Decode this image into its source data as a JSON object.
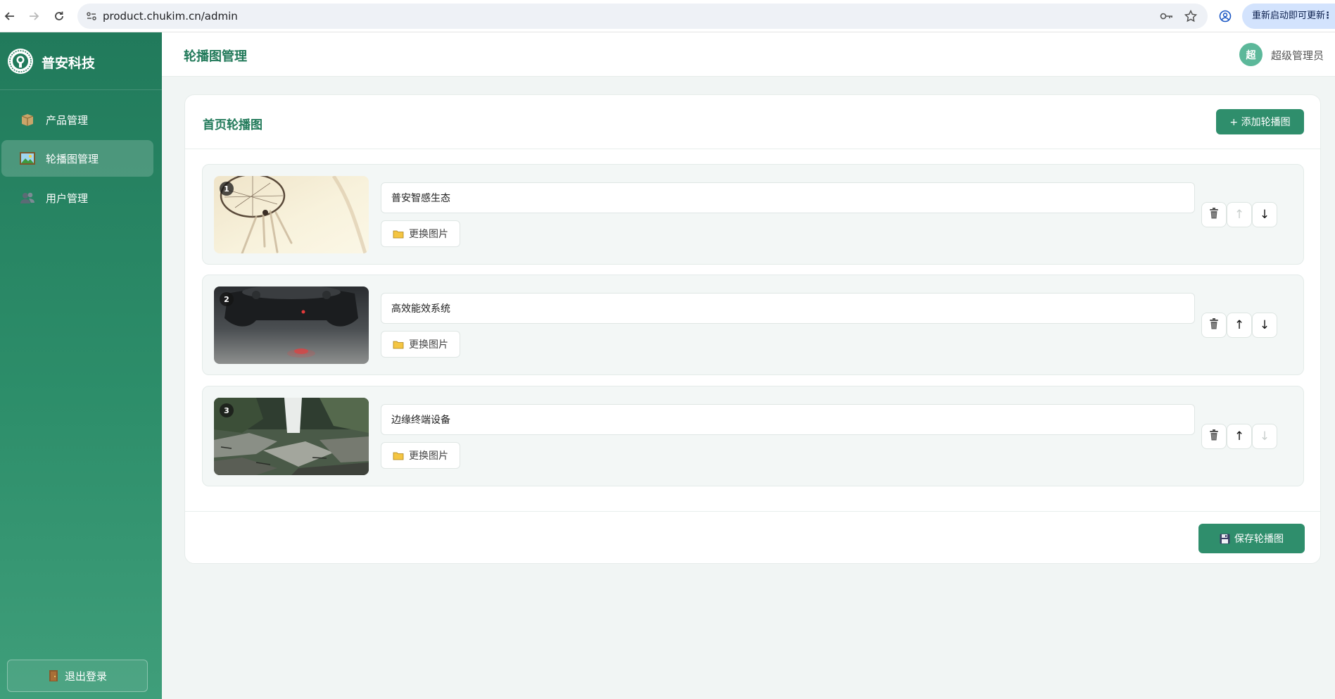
{
  "browser": {
    "url": "product.chukim.cn/admin",
    "update_label": "重新启动即可更新",
    "more_glyph": "⋮"
  },
  "sidebar": {
    "brand": "普安科技",
    "items": [
      {
        "label": "产品管理",
        "icon": "box-icon",
        "active": false
      },
      {
        "label": "轮播图管理",
        "icon": "image-icon",
        "active": true
      },
      {
        "label": "用户管理",
        "icon": "users-icon",
        "active": false
      }
    ],
    "logout_label": "退出登录"
  },
  "header": {
    "title": "轮播图管理",
    "user_avatar_char": "超",
    "user_name": "超级管理员"
  },
  "card": {
    "title": "首页轮播图",
    "add_label": "+ 添加轮播图",
    "save_label": "保存轮播图",
    "change_image_label": "更换图片",
    "slides": [
      {
        "index": "1",
        "title": "普安智感生态",
        "image": "dreamcatcher",
        "can_move_up": false,
        "can_move_down": true
      },
      {
        "index": "2",
        "title": "高效能效系统",
        "image": "gamepad",
        "can_move_up": true,
        "can_move_down": true
      },
      {
        "index": "3",
        "title": "边缘终端设备",
        "image": "waterfall-rocks",
        "can_move_up": true,
        "can_move_down": false
      }
    ]
  },
  "colors": {
    "brand_green": "#2f8e6c",
    "title_green": "#227a5a",
    "avatar": "#5cb89a"
  }
}
